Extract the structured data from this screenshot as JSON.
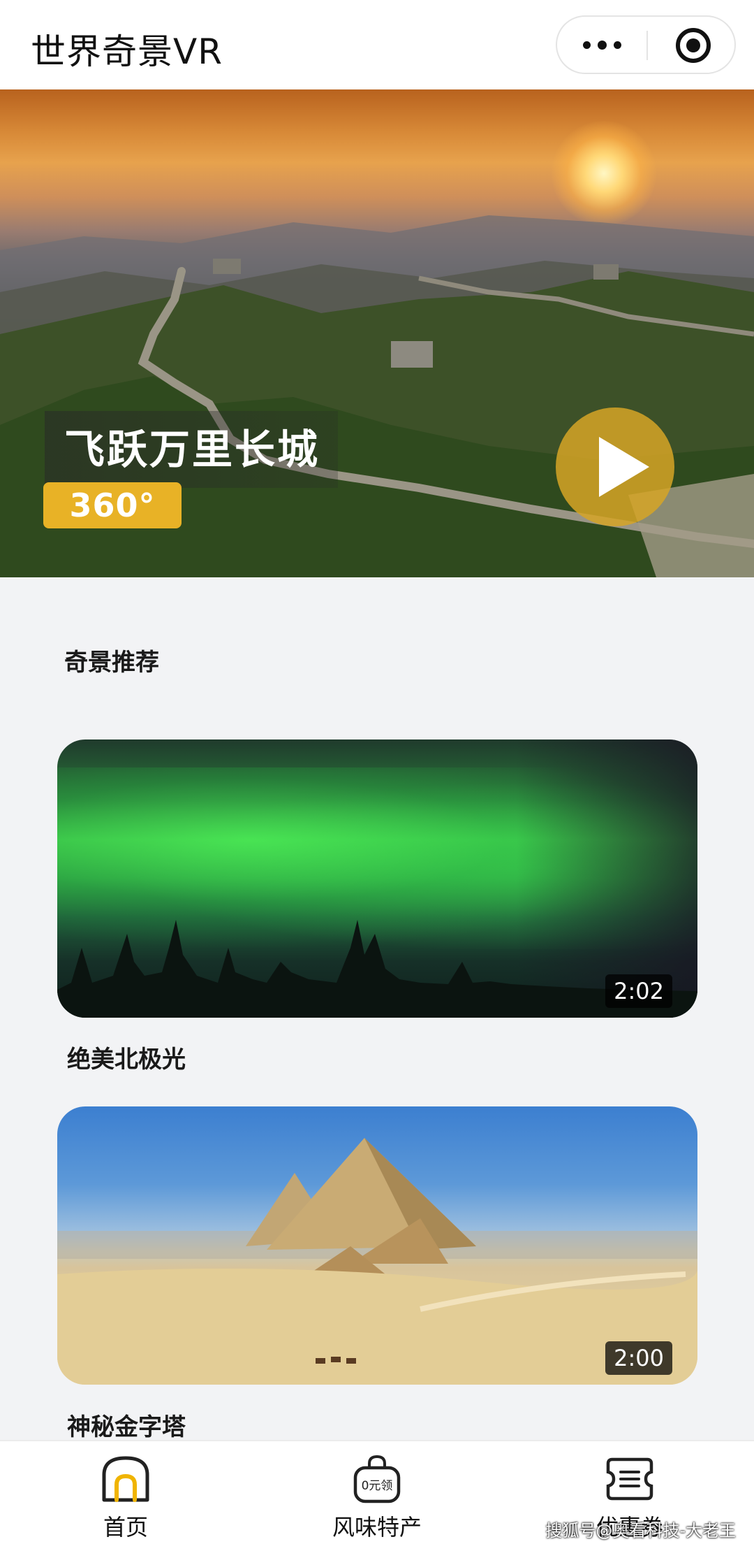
{
  "header": {
    "title": "世界奇景VR",
    "more_icon": "more-dots-icon",
    "close_icon": "target-circle-icon"
  },
  "hero": {
    "title": "飞跃万里长城",
    "badge": "360°",
    "play_icon": "play-icon"
  },
  "section": {
    "title": "奇景推荐"
  },
  "videos": [
    {
      "title": "绝美北极光",
      "duration": "2:02"
    },
    {
      "title": "神秘金字塔",
      "duration": "2:00"
    }
  ],
  "tabbar": {
    "items": [
      {
        "label": "首页",
        "icon": "home-icon",
        "active": true
      },
      {
        "label": "风味特产",
        "icon": "shopping-bag-icon",
        "icon_text": "0元领"
      },
      {
        "label": "优惠券",
        "icon": "coupon-icon"
      }
    ]
  },
  "watermark": "搜狐号@奥看科技-大老王",
  "colors": {
    "accent": "#e8b226",
    "play_button": "#d6a426",
    "home_icon_accent": "#f0b400"
  }
}
